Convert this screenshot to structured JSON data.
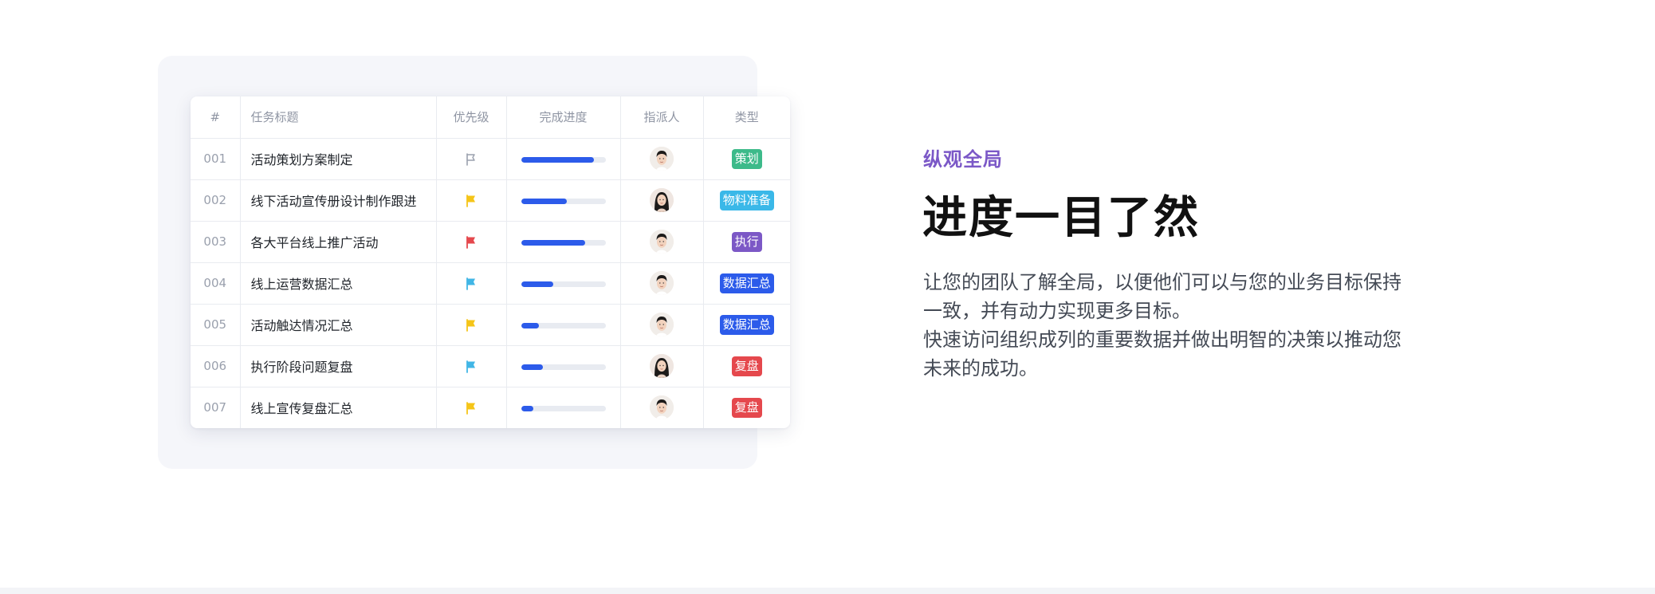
{
  "table": {
    "headers": {
      "num": "#",
      "title": "任务标题",
      "priority": "优先级",
      "progress": "完成进度",
      "assignee": "指派人",
      "type": "类型"
    },
    "rows": [
      {
        "num": "001",
        "title": "活动策划方案制定",
        "priority": "none",
        "progress": 0.86,
        "avatar": "male",
        "tag": "策划",
        "tag_color": "#3dba8a"
      },
      {
        "num": "002",
        "title": "线下活动宣传册设计制作跟进",
        "priority": "medium",
        "progress": 0.54,
        "avatar": "female",
        "tag": "物料准备",
        "tag_color": "#3ab8e8"
      },
      {
        "num": "003",
        "title": "各大平台线上推广活动",
        "priority": "high",
        "progress": 0.76,
        "avatar": "male",
        "tag": "执行",
        "tag_color": "#7c58c6"
      },
      {
        "num": "004",
        "title": "线上运营数据汇总",
        "priority": "low",
        "progress": 0.38,
        "avatar": "male",
        "tag": "数据汇总",
        "tag_color": "#2c5bea"
      },
      {
        "num": "005",
        "title": "活动触达情况汇总",
        "priority": "medium",
        "progress": 0.21,
        "avatar": "male",
        "tag": "数据汇总",
        "tag_color": "#2c5bea"
      },
      {
        "num": "006",
        "title": "执行阶段问题复盘",
        "priority": "low",
        "progress": 0.26,
        "avatar": "female",
        "tag": "复盘",
        "tag_color": "#e5484d"
      },
      {
        "num": "007",
        "title": "线上宣传复盘汇总",
        "priority": "medium",
        "progress": 0.15,
        "avatar": "male",
        "tag": "复盘",
        "tag_color": "#e5484d"
      }
    ]
  },
  "colors": {
    "flag_none": "#9aa0ad",
    "flag_medium": "#f5c518",
    "flag_high": "#e5484d",
    "flag_low": "#41b6e6",
    "progress_fill": "#2c5bea",
    "eyebrow": "#7b58c7"
  },
  "feature": {
    "eyebrow": "纵观全局",
    "headline": "进度一目了然",
    "desc_line1": "让您的团队了解全局，以便他们可以与您的业务目标保持一致，并有动力实现更多目标。",
    "desc_line2": "快速访问组织成列的重要数据并做出明智的决策以推动您未来的成功。"
  }
}
